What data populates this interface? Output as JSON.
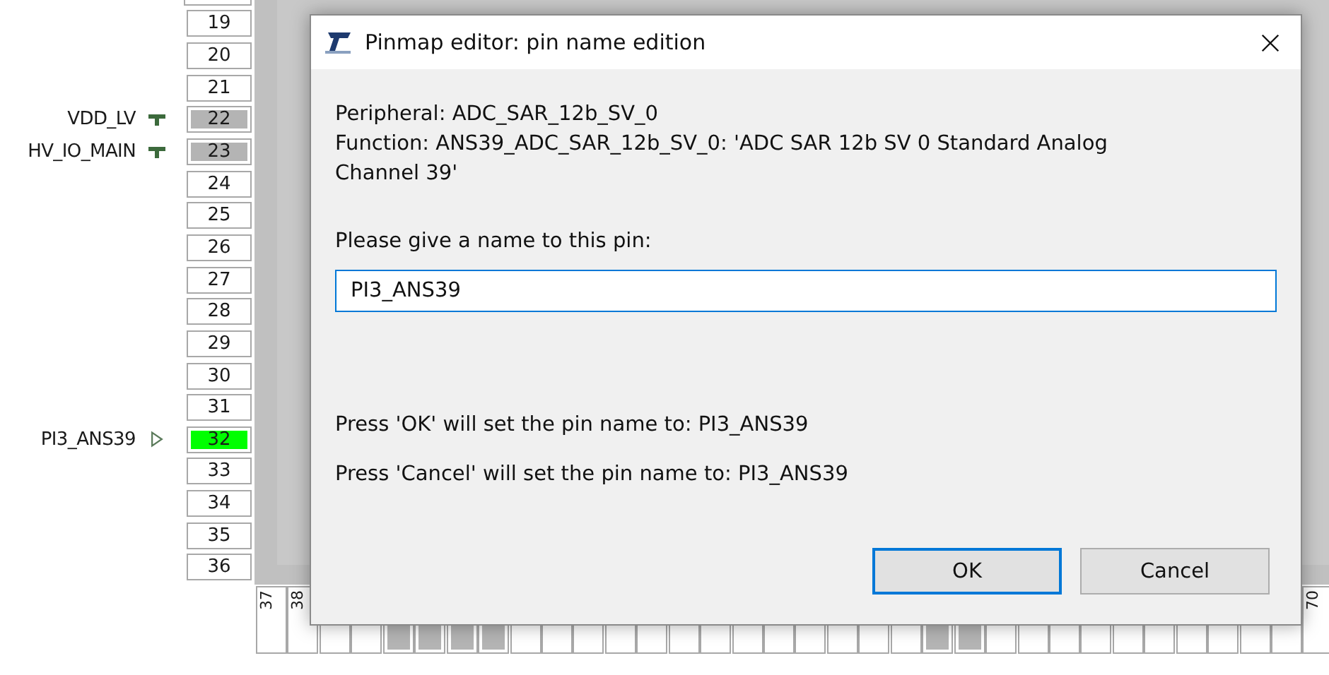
{
  "left_pins": [
    {
      "number": "19",
      "kind": "free"
    },
    {
      "number": "20",
      "kind": "free"
    },
    {
      "number": "21",
      "kind": "free"
    },
    {
      "number": "22",
      "kind": "power",
      "label": "VDD_LV"
    },
    {
      "number": "23",
      "kind": "power",
      "label": "HV_IO_MAIN"
    },
    {
      "number": "24",
      "kind": "free"
    },
    {
      "number": "25",
      "kind": "free"
    },
    {
      "number": "26",
      "kind": "free"
    },
    {
      "number": "27",
      "kind": "free"
    },
    {
      "number": "28",
      "kind": "free"
    },
    {
      "number": "29",
      "kind": "free"
    },
    {
      "number": "30",
      "kind": "free"
    },
    {
      "number": "31",
      "kind": "free"
    },
    {
      "number": "32",
      "kind": "assigned",
      "label": "PI3_ANS39"
    },
    {
      "number": "33",
      "kind": "free"
    },
    {
      "number": "34",
      "kind": "free"
    },
    {
      "number": "35",
      "kind": "free"
    },
    {
      "number": "36",
      "kind": "free"
    }
  ],
  "bottom_pins": [
    {
      "number": "37",
      "kind": "free"
    },
    {
      "number": "38",
      "kind": "free"
    },
    {
      "kind": "free"
    },
    {
      "kind": "free"
    },
    {
      "kind": "power"
    },
    {
      "kind": "power"
    },
    {
      "kind": "power"
    },
    {
      "kind": "power"
    },
    {
      "kind": "free"
    },
    {
      "kind": "free"
    },
    {
      "kind": "free"
    },
    {
      "kind": "free"
    },
    {
      "kind": "free"
    },
    {
      "kind": "free"
    },
    {
      "kind": "free"
    },
    {
      "kind": "free"
    },
    {
      "kind": "free"
    },
    {
      "kind": "free"
    },
    {
      "kind": "free"
    },
    {
      "kind": "free"
    },
    {
      "kind": "free"
    },
    {
      "kind": "power"
    },
    {
      "kind": "power"
    },
    {
      "kind": "free"
    },
    {
      "kind": "free"
    },
    {
      "kind": "free"
    },
    {
      "kind": "free"
    },
    {
      "kind": "free"
    },
    {
      "kind": "free"
    },
    {
      "kind": "free"
    },
    {
      "kind": "free"
    },
    {
      "kind": "free"
    },
    {
      "kind": "free"
    },
    {
      "number": "70",
      "kind": "free"
    }
  ],
  "dialog": {
    "title": "Pinmap editor: pin name edition",
    "peripheral": "Peripheral: ADC_SAR_12b_SV_0",
    "function": "Function: ANS39_ADC_SAR_12b_SV_0: 'ADC SAR 12b SV 0 Standard Analog Channel 39'",
    "prompt": "Please give a name to this pin:",
    "name_value": "PI3_ANS39",
    "ok_note": "Press 'OK' will set the pin name to: PI3_ANS39",
    "cancel_note": "Press 'Cancel' will set the pin name to: PI3_ANS39",
    "buttons": [
      {
        "label": "OK",
        "default": true
      },
      {
        "label": "Cancel",
        "default": false
      }
    ]
  }
}
